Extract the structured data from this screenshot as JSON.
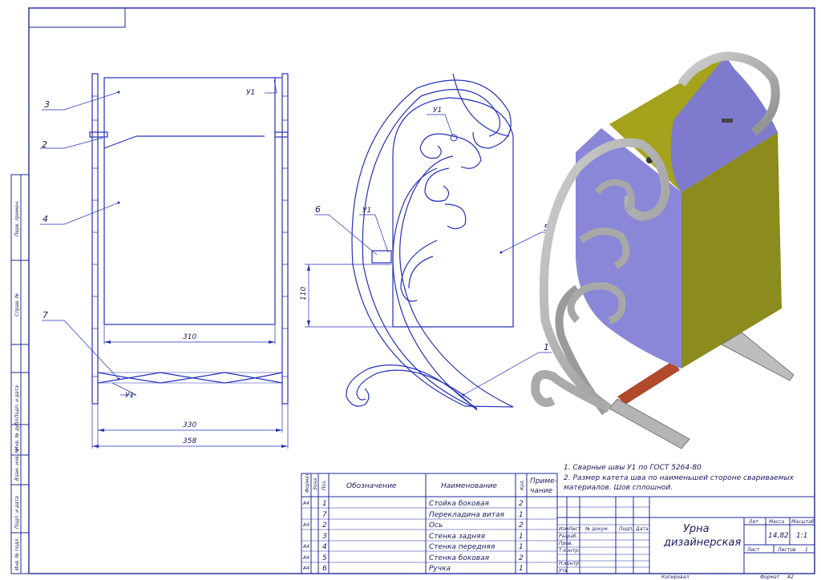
{
  "colors": {
    "frame": "#1f2a9a",
    "line": "#2430b8",
    "metal": "#b4b4b4",
    "metalDark": "#7c7c7c",
    "box": "#8a86d8",
    "lid": "#8b8b1e",
    "axis": "#b04a2a",
    "text": "#1b1b5e"
  },
  "callouts": {
    "c1": "1",
    "c2": "2",
    "c3": "3",
    "c4": "4",
    "c5": "5",
    "c6": "6",
    "c7": "7"
  },
  "welds": {
    "w1": "У1",
    "w2": "У1",
    "w3": "У1",
    "w4": "У1"
  },
  "dims": {
    "d310": "310",
    "d330": "330",
    "d358": "358",
    "d110": "110"
  },
  "side_labels": [
    "Перв. примен.",
    "Справ. №",
    "Подп. и дата",
    "Инв. № дубл.",
    "Взам. инв. №",
    "Подп. и дата",
    "Инв. № подл."
  ],
  "notes": [
    "1. Сварные швы У1 по ГОСТ 5264-80",
    "2. Размер катета шва по наименьшей стороне свариваемых",
    "материалов. Шов сплошной."
  ],
  "spec": {
    "headers": {
      "format": "Формат",
      "zone": "Зона",
      "pos": "Поз.",
      "designation": "Обозначение",
      "name": "Наименование",
      "qty": "Кол.",
      "note1": "Приме-",
      "note2": "чание"
    },
    "rows": [
      {
        "format": "А4",
        "pos": "1",
        "name": "Стойка боковая",
        "qty": "2"
      },
      {
        "format": "",
        "pos": "7",
        "name": "Перекладина витая",
        "qty": "1"
      },
      {
        "format": "А4",
        "pos": "2",
        "name": "Ось",
        "qty": "2"
      },
      {
        "format": "",
        "pos": "3",
        "name": "Стенка задняя",
        "qty": "1"
      },
      {
        "format": "А4",
        "pos": "4",
        "name": "Стенка передняя",
        "qty": "1"
      },
      {
        "format": "А4",
        "pos": "5",
        "name": "Стенка боковая",
        "qty": "2"
      },
      {
        "format": "А4",
        "pos": "6",
        "name": "Ручка",
        "qty": "1"
      }
    ]
  },
  "title_block": {
    "title1": "Урна",
    "title2": "дизайнерская",
    "lit": "Лит",
    "mass": "Масса",
    "scale": "Масштаб",
    "mass_value": "14,82",
    "scale_value": "1:1",
    "sheet": "Лист",
    "sheets": "Листов",
    "sheets_value": "1",
    "hdr_izm": "Изм",
    "hdr_list": "Лист",
    "hdr_doc": "№ докум.",
    "hdr_podp": "Подп.",
    "hdr_date": "Дата",
    "roles": [
      "Разраб.",
      "Пров.",
      "Т.контр.",
      "",
      "Н.контр.",
      "Утв."
    ]
  },
  "footer": {
    "copied": "Копировал",
    "format_label": "Формат",
    "format_value": "А2"
  }
}
